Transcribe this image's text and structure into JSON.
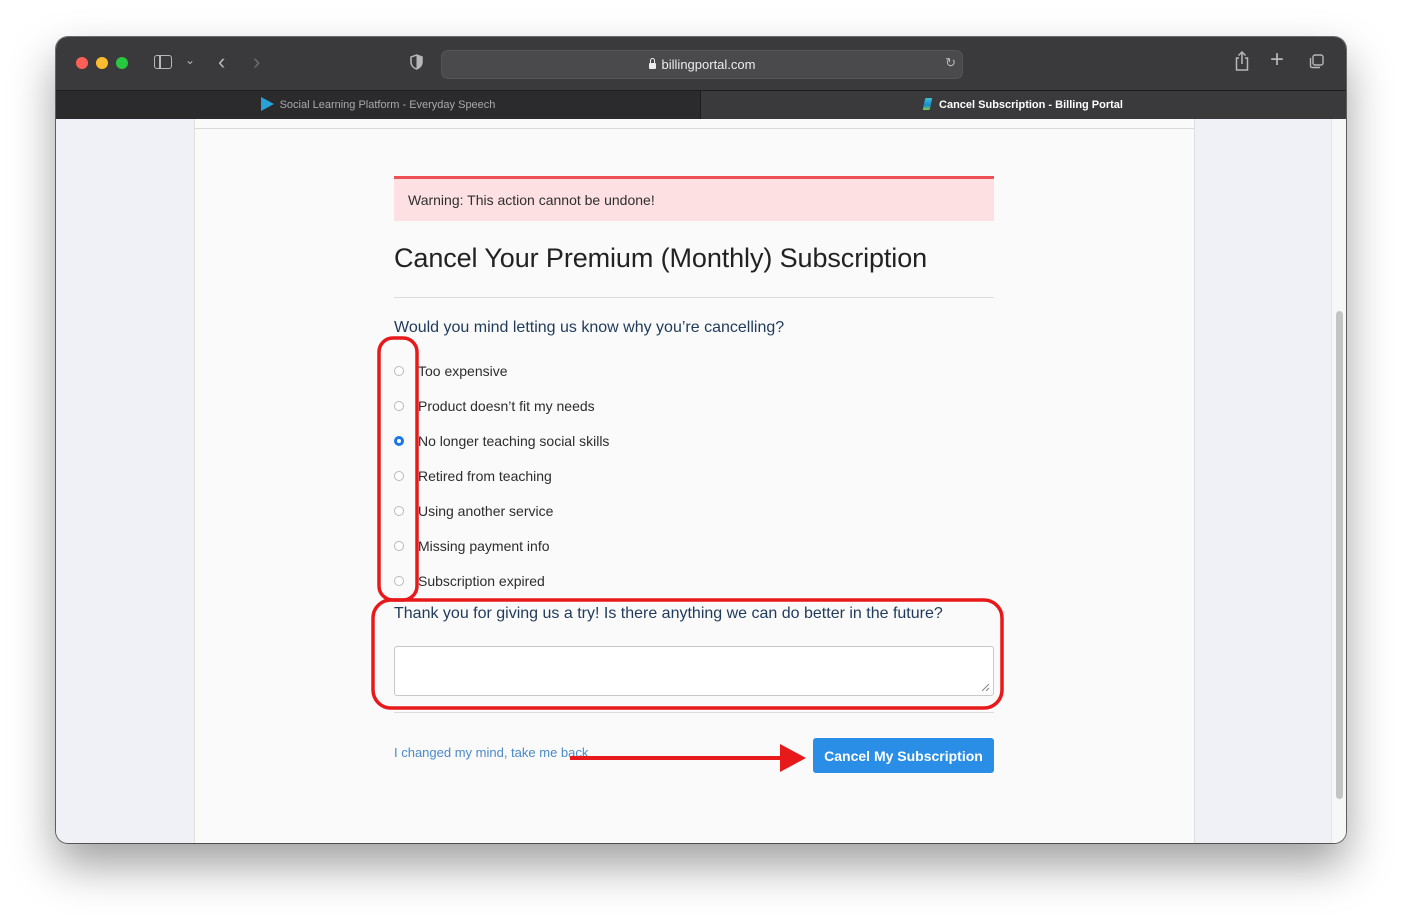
{
  "browser": {
    "url": "billingportal.com",
    "tabs": [
      {
        "title": "Social Learning Platform - Everyday Speech",
        "active": false
      },
      {
        "title": "Cancel Subscription - Billing Portal",
        "active": true
      }
    ]
  },
  "page": {
    "warning": "Warning: This action cannot be undone!",
    "title": "Cancel Your Premium (Monthly) Subscription",
    "reason_question": "Would you mind letting us know why you’re cancelling?",
    "reasons": [
      {
        "label": "Too expensive",
        "checked": false
      },
      {
        "label": "Product doesn’t fit my needs",
        "checked": false
      },
      {
        "label": "No longer teaching social skills",
        "checked": true
      },
      {
        "label": "Retired from teaching",
        "checked": false
      },
      {
        "label": "Using another service",
        "checked": false
      },
      {
        "label": "Missing payment info",
        "checked": false
      },
      {
        "label": "Subscription expired",
        "checked": false
      }
    ],
    "feedback_question": "Thank you for giving us a try! Is there anything we can do better in the future?",
    "feedback_value": "",
    "back_link": "I changed my mind, take me back",
    "cancel_button": "Cancel My Subscription"
  },
  "colors": {
    "primary_button": "#2a8ee7",
    "warning_bg": "#fde1e2",
    "warning_border": "#ef5055",
    "annotation": "#e8191b",
    "radio_checked": "#1a75e8"
  }
}
